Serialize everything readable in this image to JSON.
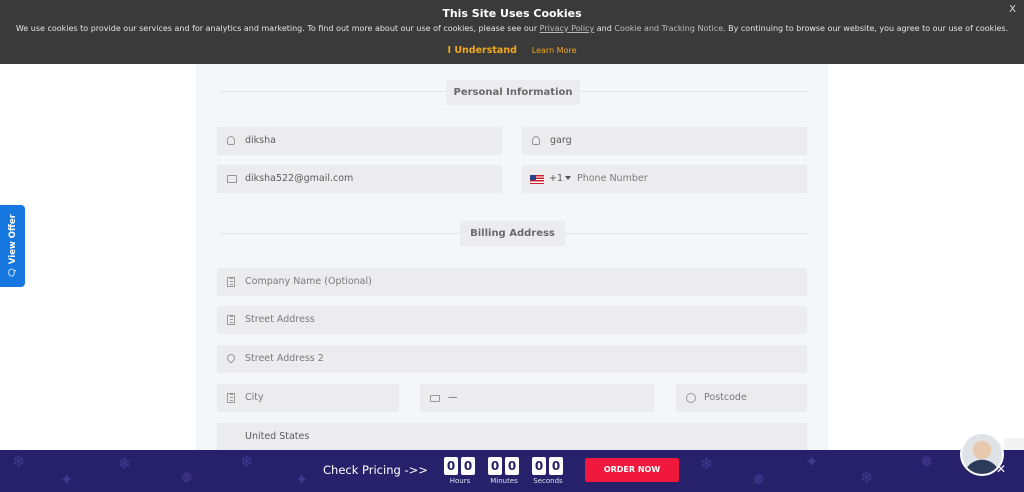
{
  "cookie": {
    "title": "This Site Uses Cookies",
    "text_before": "We use cookies to provide our services and for analytics and marketing. To find out more about our use of cookies, please see our ",
    "privacy_link": "Privacy Policy",
    "text_and": " and ",
    "notice_link": "Cookie and Tracking Notice",
    "text_after": ". By continuing to browse our website, you agree to our use of cookies.",
    "understand_label": "I Understand",
    "learn_more_label": "Learn More",
    "close_label": "X"
  },
  "form": {
    "personal_title": "Personal Information",
    "first_name": "diksha",
    "last_name": "garg",
    "email": "diksha522@gmail.com",
    "phone_dial_code": "+1",
    "phone_placeholder": "Phone Number",
    "billing_title": "Billing Address",
    "company_placeholder": "Company Name (Optional)",
    "street_placeholder": "Street Address",
    "street2_placeholder": "Street Address 2",
    "city_placeholder": "City",
    "state_value": "—",
    "postcode_placeholder": "Postcode",
    "country_value": "United States"
  },
  "side_tab": {
    "label": "View Offer"
  },
  "promo": {
    "check_pricing": "Check Pricing ->>",
    "hours": [
      "0",
      "0"
    ],
    "minutes": [
      "0",
      "0"
    ],
    "seconds": [
      "0",
      "0"
    ],
    "hours_label": "Hours",
    "minutes_label": "Minutes",
    "seconds_label": "Seconds",
    "order_label": "ORDER NOW",
    "close_label": "✕"
  },
  "icons": {
    "first_name": "user-icon",
    "last_name": "user-icon",
    "email": "envelope-icon",
    "phone": "us-flag-icon",
    "company": "building-icon",
    "street": "building-icon",
    "street2": "map-pin-icon",
    "city": "building-icon",
    "state": "chat-bubble-icon",
    "postcode": "circle-icon"
  },
  "colors": {
    "cookie_bg": "#3a3a3a",
    "accent_orange": "#f0a81c",
    "promo_bg": "#27206b",
    "order_red": "#f0183c",
    "view_offer_blue": "#1677e0"
  }
}
